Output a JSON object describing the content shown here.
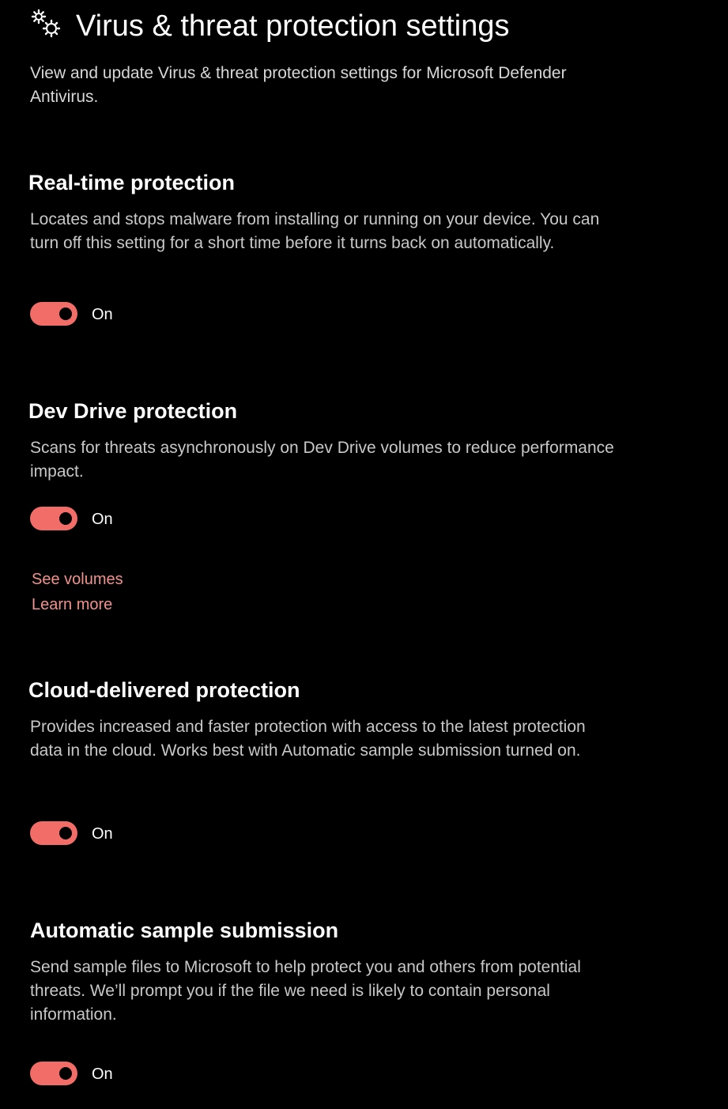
{
  "header": {
    "icon": "gears-icon",
    "title": "Virus & threat protection settings",
    "subtitle": "View and update Virus & threat protection settings for Microsoft Defender Antivirus."
  },
  "accent_color": "#f26d68",
  "link_color": "#f0928c",
  "sections": [
    {
      "title": "Real-time protection",
      "description": "Locates and stops malware from installing or running on your device. You can turn off this setting for a short time before it turns back on automatically.",
      "toggle": {
        "state": "on",
        "label": "On"
      }
    },
    {
      "title": "Dev Drive protection",
      "description": "Scans for threats asynchronously on Dev Drive volumes to reduce performance impact.",
      "toggle": {
        "state": "on",
        "label": "On"
      },
      "links": [
        "See volumes",
        "Learn more"
      ]
    },
    {
      "title": "Cloud-delivered protection",
      "description": "Provides increased and faster protection with access to the latest protection data in the cloud. Works best with Automatic sample submission turned on.",
      "toggle": {
        "state": "on",
        "label": "On"
      }
    },
    {
      "title": "Automatic sample submission",
      "description": "Send sample files to Microsoft to help protect you and others from potential threats. We’ll prompt you if the file we need is likely to contain personal information.",
      "toggle": {
        "state": "on",
        "label": "On"
      }
    }
  ]
}
